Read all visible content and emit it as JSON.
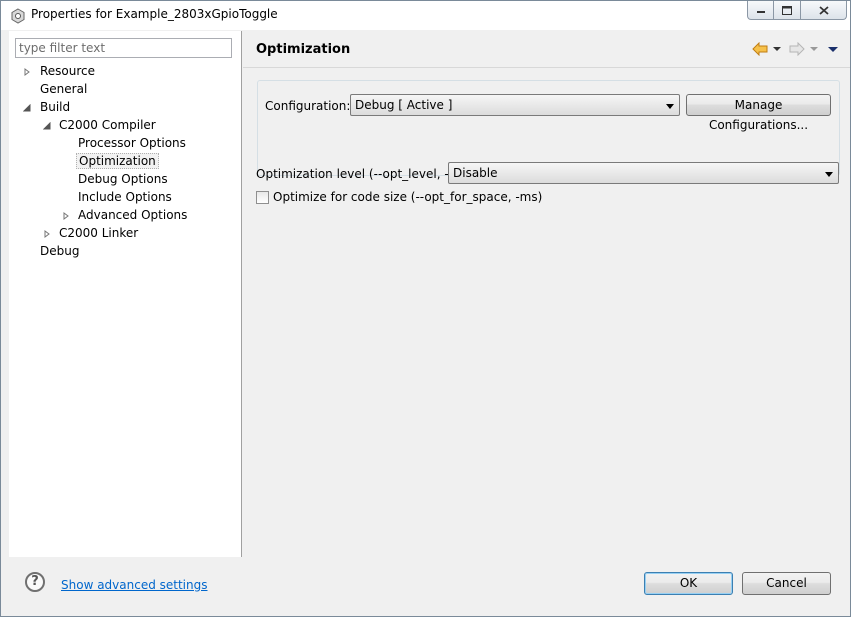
{
  "window": {
    "title": "Properties for Example_2803xGpioToggle",
    "icons": {
      "app": "properties-gear-icon",
      "minimize": "minimize-icon",
      "maximize": "maximize-icon",
      "close": "close-icon"
    }
  },
  "filter": {
    "placeholder": "type filter text",
    "value": ""
  },
  "tree": {
    "items": [
      {
        "label": "Resource",
        "expander": "collapsed"
      },
      {
        "label": "General",
        "expander": "none"
      },
      {
        "label": "Build",
        "expander": "expanded"
      },
      {
        "label": "C2000 Compiler",
        "expander": "expanded"
      },
      {
        "label": "Processor Options",
        "expander": "none"
      },
      {
        "label": "Optimization",
        "expander": "none",
        "selected": true
      },
      {
        "label": "Debug Options",
        "expander": "none"
      },
      {
        "label": "Include Options",
        "expander": "none"
      },
      {
        "label": "Advanced Options",
        "expander": "collapsed"
      },
      {
        "label": "C2000 Linker",
        "expander": "collapsed"
      },
      {
        "label": "Debug",
        "expander": "none"
      }
    ]
  },
  "page": {
    "title": "Optimization",
    "nav_icons": [
      "back-arrow-icon",
      "back-dropdown-icon",
      "forward-arrow-icon",
      "forward-dropdown-icon",
      "view-menu-icon"
    ]
  },
  "configuration": {
    "label": "Configuration:",
    "selected": "Debug  [ Active ]",
    "manage_button": "Manage Configurations..."
  },
  "optimization": {
    "level_label": "Optimization level (--opt_level, -O)",
    "level_value": "Disable",
    "size_checkbox_label": "Optimize for code size (--opt_for_space, -ms)",
    "size_checked": false
  },
  "footer": {
    "help_icon": "help-icon",
    "help_glyph": "?",
    "advanced_link": "Show advanced settings",
    "ok": "OK",
    "cancel": "Cancel"
  },
  "colors": {
    "link": "#0066cc",
    "default_button_border": "#3c7fb1",
    "nav_arrow": "#e8a33a"
  }
}
